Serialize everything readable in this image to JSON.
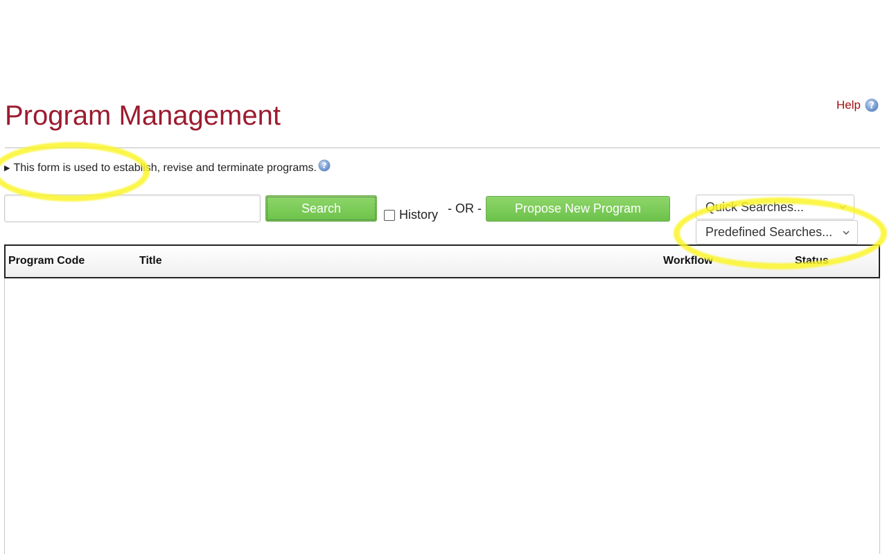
{
  "header": {
    "title": "Program Management",
    "help_label": "Help"
  },
  "description": {
    "text": "This form is used to establish, revise and terminate programs."
  },
  "search": {
    "placeholder": "",
    "value": "",
    "button_label": "Search",
    "history_label": "History",
    "history_checked": false,
    "or_text": "- OR -",
    "propose_label": "Propose New Program"
  },
  "selects": {
    "quick_searches": "Quick Searches...",
    "predefined_searches": "Predefined Searches..."
  },
  "table": {
    "columns": [
      "Program Code",
      "Title",
      "Workflow",
      "Status"
    ],
    "rows": []
  },
  "colors": {
    "title": "#9b1b30",
    "help": "#a30d0d",
    "button_green": "#6cc24a",
    "highlight": "#faf528"
  },
  "icons": {
    "help": "help-icon",
    "info": "info-icon",
    "expand": "triangle-right-icon",
    "dropdown": "chevron-down-icon"
  }
}
